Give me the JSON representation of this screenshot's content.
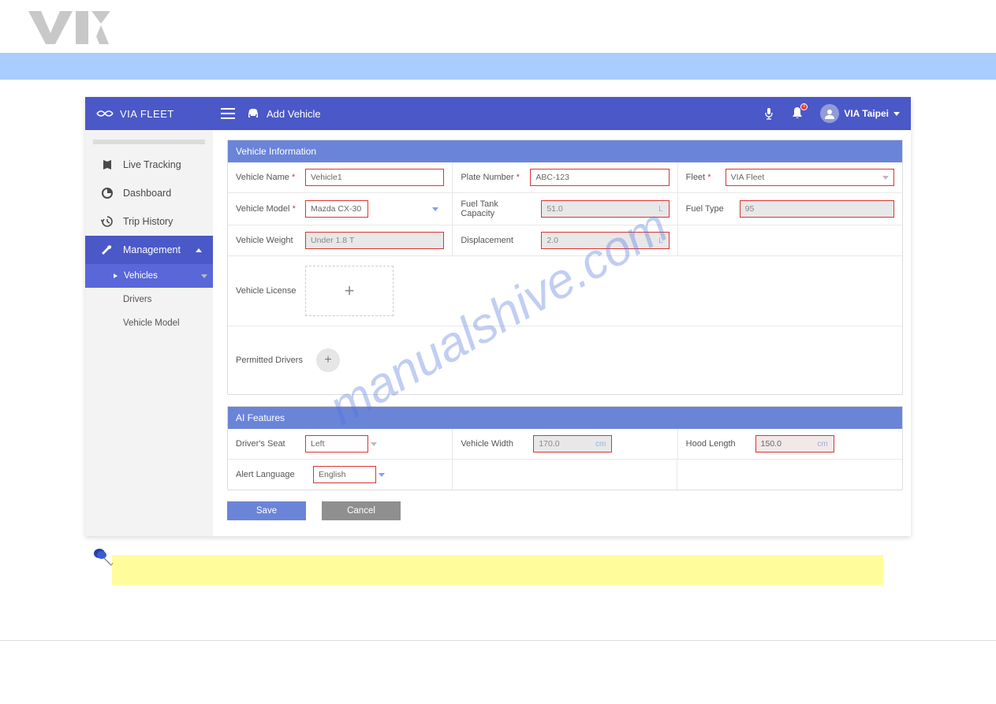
{
  "brand": "VIA FLEET",
  "page_title": "Add Vehicle",
  "user_name": "VIA Taipei",
  "bell_count": "0",
  "sidebar": {
    "items": [
      {
        "label": "Live Tracking"
      },
      {
        "label": "Dashboard"
      },
      {
        "label": "Trip History"
      },
      {
        "label": "Management"
      }
    ],
    "sub": [
      {
        "label": "Vehicles"
      },
      {
        "label": "Drivers"
      },
      {
        "label": "Vehicle Model"
      }
    ]
  },
  "section1_title": "Vehicle Information",
  "fields": {
    "vehicle_name": {
      "label": "Vehicle Name",
      "value": "Vehicle1"
    },
    "plate_number": {
      "label": "Plate Number",
      "value": "ABC-123"
    },
    "fleet": {
      "label": "Fleet",
      "value": "VIA Fleet"
    },
    "vehicle_model": {
      "label": "Vehicle Model",
      "value": "Mazda CX-30"
    },
    "fuel_tank": {
      "label": "Fuel Tank Capacity",
      "value": "51.0",
      "unit": "L"
    },
    "fuel_type": {
      "label": "Fuel Type",
      "value": "95"
    },
    "vehicle_weight": {
      "label": "Vehicle Weight",
      "value": "Under 1.8 T"
    },
    "displacement": {
      "label": "Displacement",
      "value": "2.0",
      "unit": "L"
    },
    "vehicle_license": {
      "label": "Vehicle License"
    },
    "permitted_drivers": {
      "label": "Permitted Drivers"
    }
  },
  "section2_title": "AI Features",
  "ai": {
    "driver_seat": {
      "label": "Driver's Seat",
      "value": "Left"
    },
    "vehicle_width": {
      "label": "Vehicle Width",
      "value": "170.0",
      "unit": "cm"
    },
    "hood_length": {
      "label": "Hood Length",
      "value": "150.0",
      "unit": "cm"
    },
    "alert_lang": {
      "label": "Alert Language",
      "value": "English"
    }
  },
  "buttons": {
    "save": "Save",
    "cancel": "Cancel"
  },
  "watermark": "manualshive.com"
}
